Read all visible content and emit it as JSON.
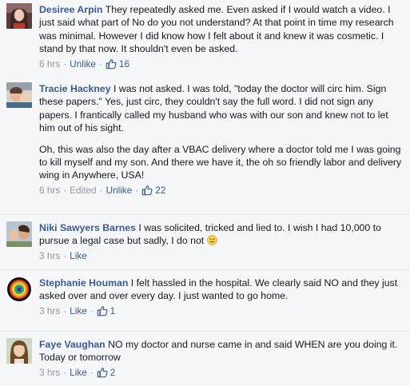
{
  "comments": [
    {
      "author": "Desiree Arpin",
      "text": "They repeatedly asked me. Even asked if I would watch a video. I just said what part of No do you not understand? At that point in time my research was minimal. However I did know how I felt about it and knew it was cosmetic. I stand by that now. It shouldn't even be asked.",
      "time": "6 hrs",
      "action": "Unlike",
      "likes": "16"
    },
    {
      "author": "Tracie Hackney",
      "text": "I was not asked. I was told, \"today the doctor will circ him. Sign these papers.\" Yes, just circ, they couldn't say the full word. I did not sign any papers. I frantically called my husband who was with our son and knew not to let him out of his sight.",
      "text2": "Oh, this was also the day after a VBAC delivery where a doctor told me I was going to kill myself and my son. And there we have it, the oh so friendly labor and delivery wing in Anywhere, USA!",
      "time": "6 hrs",
      "edited": "Edited",
      "action": "Unlike",
      "likes": "22"
    },
    {
      "author": "Niki Sawyers Barnes",
      "text": "I was solicited, tricked and lied to. I wish I had 10,000 to pursue a legal case but sadly, I do not",
      "time": "3 hrs",
      "action": "Like"
    },
    {
      "author": "Stephanie Houman",
      "text": "I felt hassled in the hospital. We clearly said NO and they just asked over and over every day. I just wanted to go home.",
      "time": "3 hrs",
      "action": "Like",
      "likes": "1"
    },
    {
      "author": "Faye Vaughan",
      "text": "NO my doctor and nurse came in and said WHEN are you doing it. Today or tomorrow",
      "time": "3 hrs",
      "action": "Like",
      "likes": "2"
    }
  ],
  "icons": {
    "like": "thumbs-up-icon",
    "emoji": "frown-emoji-icon"
  },
  "colors": {
    "link": "#3b5998",
    "meta": "#9197a3",
    "text": "#141823",
    "background": "#f6f7f9"
  }
}
